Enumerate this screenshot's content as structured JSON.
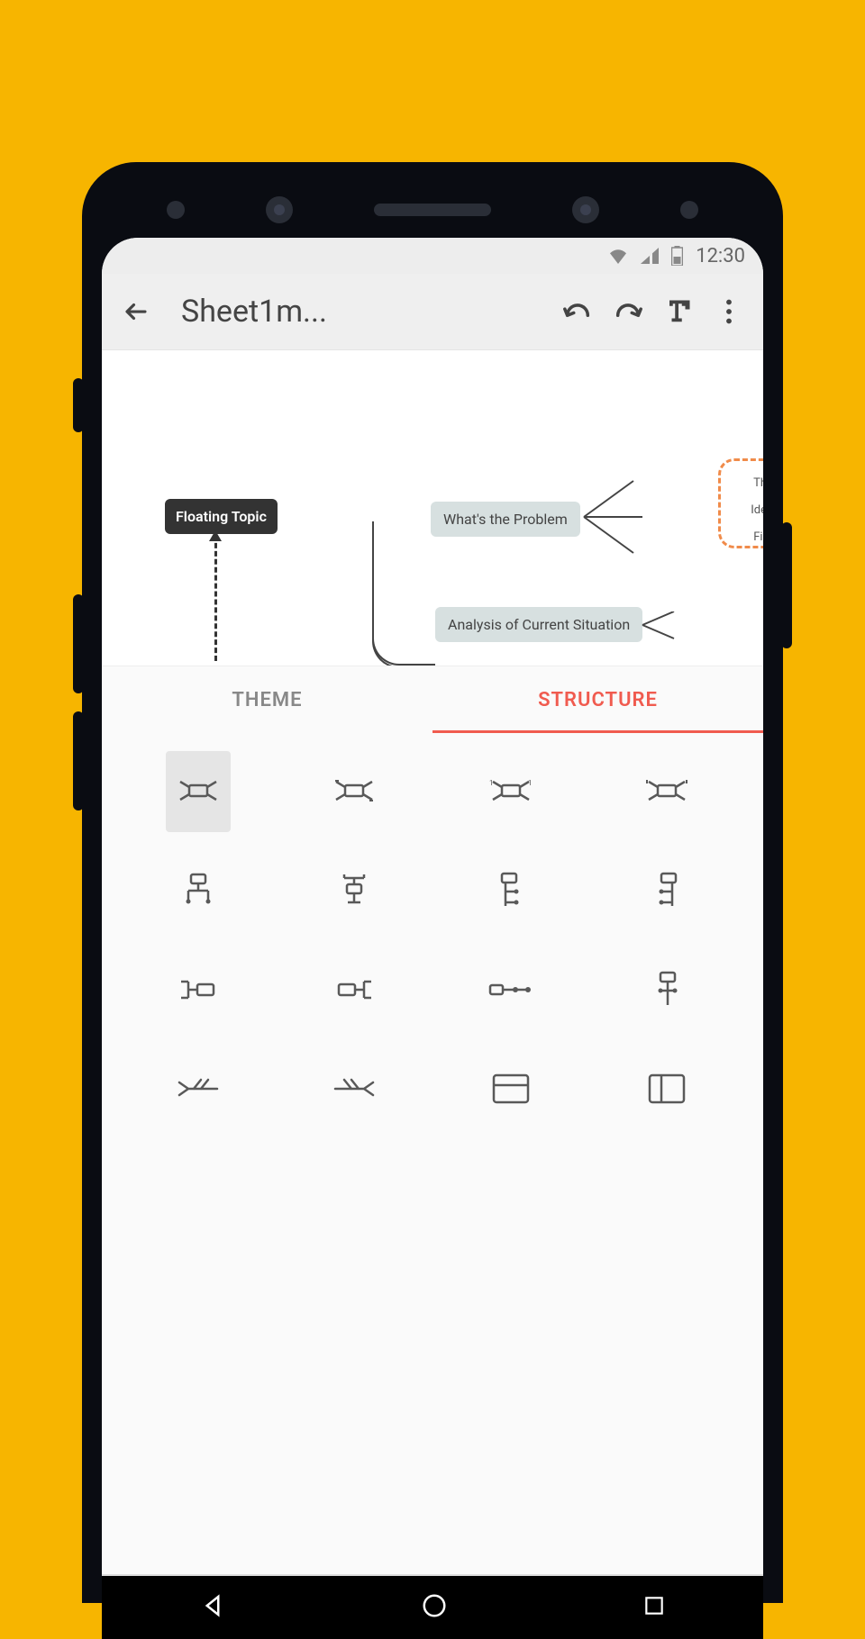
{
  "status_bar": {
    "time": "12:30"
  },
  "toolbar": {
    "title": "Sheet1m..."
  },
  "canvas": {
    "floating_topic": "Floating Topic",
    "node1": "What's the Problem",
    "node2": "Analysis of Current Situation",
    "sub1": "Th",
    "sub2": "Ide",
    "sub3": "Fir"
  },
  "tabs": {
    "theme": "THEME",
    "structure": "STRUCTURE",
    "active": "structure"
  },
  "structure_options": [
    {
      "name": "map-balanced",
      "selected": true
    },
    {
      "name": "map-clockwise",
      "selected": false
    },
    {
      "name": "map-anticlockwise",
      "selected": false
    },
    {
      "name": "map-timeline",
      "selected": false
    },
    {
      "name": "org-chart-down",
      "selected": false
    },
    {
      "name": "org-chart-up",
      "selected": false
    },
    {
      "name": "tree-right",
      "selected": false
    },
    {
      "name": "tree-left",
      "selected": false
    },
    {
      "name": "logic-right",
      "selected": false
    },
    {
      "name": "logic-left",
      "selected": false
    },
    {
      "name": "timeline-horizontal",
      "selected": false
    },
    {
      "name": "tree-table",
      "selected": false
    },
    {
      "name": "fishbone-left",
      "selected": false
    },
    {
      "name": "fishbone-right",
      "selected": false
    },
    {
      "name": "matrix-rows",
      "selected": false
    },
    {
      "name": "matrix-columns",
      "selected": false
    }
  ]
}
